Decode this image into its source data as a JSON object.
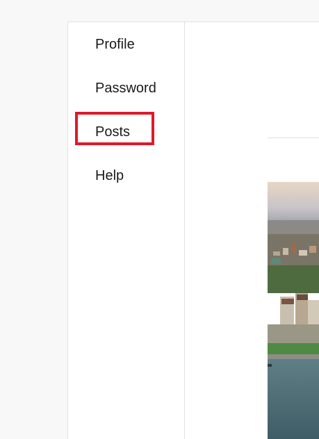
{
  "sidebar": {
    "items": [
      {
        "label": "Profile"
      },
      {
        "label": "Password"
      },
      {
        "label": "Posts",
        "highlighted": true
      },
      {
        "label": "Help"
      }
    ]
  },
  "colors": {
    "highlight_border": "#e0182a",
    "sidebar_divider": "#e0e0e0",
    "page_background": "#f8f8f8"
  },
  "post": {
    "image_icon": "city-aerial-photo"
  }
}
